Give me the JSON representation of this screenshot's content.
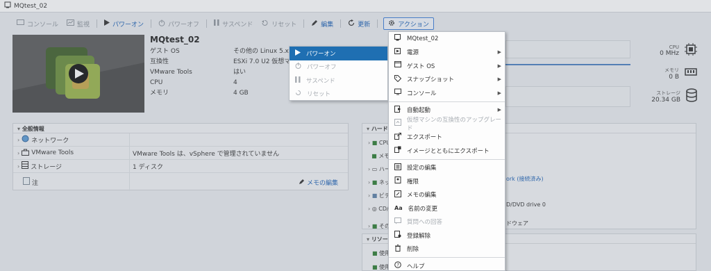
{
  "window": {
    "title": "MQtest_02"
  },
  "toolbar": {
    "console": "コンソール",
    "monitor": "監視",
    "power_on": "パワーオン",
    "power_off": "パワーオフ",
    "suspend": "サスペンド",
    "reset": "リセット",
    "edit": "編集",
    "refresh": "更新",
    "actions": "アクション"
  },
  "vm": {
    "name": "MQtest_02",
    "props": [
      {
        "k": "ゲスト OS",
        "v": "その他の Linux 5.x ("
      },
      {
        "k": "互換性",
        "v": "ESXi 7.0 U2 仮想マ"
      },
      {
        "k": "VMware Tools",
        "v": "はい"
      },
      {
        "k": "CPU",
        "v": "4"
      },
      {
        "k": "メモリ",
        "v": "4 GB"
      }
    ]
  },
  "stats": {
    "cpu_label": "CPU",
    "cpu_value": "0 MHz",
    "mem_label": "メモリ",
    "mem_value": "0 B",
    "storage_label": "ストレージ",
    "storage_value": "20.34 GB"
  },
  "general": {
    "title": "全般情報",
    "rows": [
      {
        "label": "ネットワーク",
        "value": ""
      },
      {
        "label": "VMware Tools",
        "value": "VMware Tools は、vSphere で管理されていません"
      },
      {
        "label": "ストレージ",
        "value": "1 ディスク"
      },
      {
        "label": "注",
        "value": ""
      }
    ],
    "edit_memo": "メモの編集"
  },
  "hardware": {
    "title_partial": "ハード",
    "rows": [
      "CPU",
      "メモ",
      "ハー",
      "ネッ",
      "ビデ",
      "CD/",
      "その"
    ],
    "network_text": "ork (接続済み)",
    "cd_text": "D/DVD drive 0",
    "other_text": "ドウェア"
  },
  "resources": {
    "title_partial": "リソー",
    "rows": [
      "使用",
      "使用"
    ]
  },
  "power_submenu": {
    "items": [
      {
        "label": "パワーオン",
        "disabled": false,
        "selected": true
      },
      {
        "label": "パワーオフ",
        "disabled": true
      },
      {
        "label": "サスペンド",
        "disabled": true
      },
      {
        "label": "リセット",
        "disabled": true
      }
    ]
  },
  "action_menu": {
    "items": [
      {
        "label": "MQtest_02",
        "arrow": false,
        "disabled": false
      },
      {
        "label": "電源",
        "arrow": true,
        "disabled": false
      },
      {
        "label": "ゲスト OS",
        "arrow": true,
        "disabled": false
      },
      {
        "label": "スナップショット",
        "arrow": true,
        "disabled": false
      },
      {
        "label": "コンソール",
        "arrow": true,
        "disabled": false
      },
      {
        "label": "自動起動",
        "arrow": true,
        "disabled": false
      },
      {
        "label": "仮想マシンの互換性のアップグレード",
        "arrow": false,
        "disabled": true
      },
      {
        "label": "エクスポート",
        "arrow": false,
        "disabled": false
      },
      {
        "label": "イメージとともにエクスポート",
        "arrow": false,
        "disabled": false
      },
      {
        "label": "設定の編集",
        "arrow": false,
        "disabled": false
      },
      {
        "label": "権限",
        "arrow": false,
        "disabled": false
      },
      {
        "label": "メモの編集",
        "arrow": false,
        "disabled": false
      },
      {
        "label": "名前の変更",
        "arrow": false,
        "disabled": false
      },
      {
        "label": "質問への回答",
        "arrow": false,
        "disabled": true
      },
      {
        "label": "登録解除",
        "arrow": false,
        "disabled": false
      },
      {
        "label": "削除",
        "arrow": false,
        "disabled": false
      },
      {
        "label": "ヘルプ",
        "arrow": false,
        "disabled": false
      }
    ]
  }
}
